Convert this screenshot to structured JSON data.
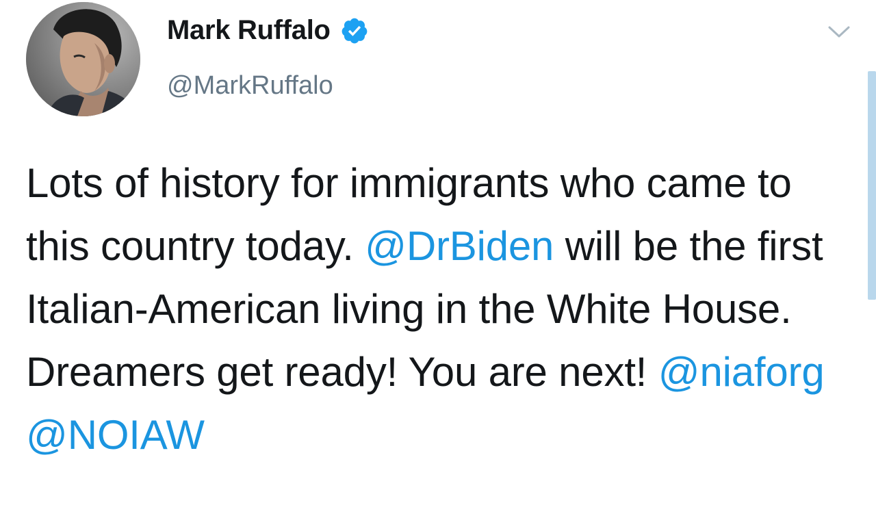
{
  "author": {
    "display_name": "Mark Ruffalo",
    "handle": "@MarkRuffalo",
    "verified": true
  },
  "icons": {
    "verified": "verified-badge-icon",
    "menu": "chevron-down-icon"
  },
  "colors": {
    "mention": "#1b95e0",
    "verified": "#1da1f2",
    "text": "#14171a",
    "handle": "#657786"
  },
  "tweet": {
    "segments": [
      {
        "text": "Lots of history for immigrants who came to this country today. ",
        "type": "text"
      },
      {
        "text": "@DrBiden",
        "type": "mention"
      },
      {
        "text": " will be the first Italian-American living in the White House. Dreamers get ready! You are next! ",
        "type": "text"
      },
      {
        "text": "@niaforg",
        "type": "mention"
      },
      {
        "text": " ",
        "type": "text"
      },
      {
        "text": "@NOIAW",
        "type": "mention"
      }
    ]
  }
}
